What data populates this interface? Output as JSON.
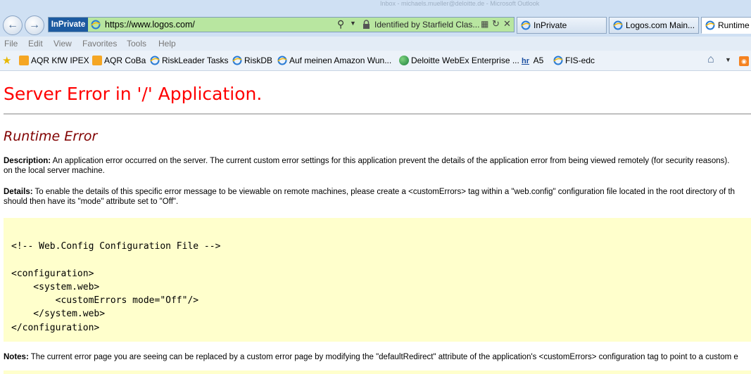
{
  "browser": {
    "faint_title": "Inbox - michaels.mueller@deloitte.de - Microsoft Outlook",
    "inprivate_label": "InPrivate",
    "url": "https://www.logos.com/",
    "identity": "Identified by Starfield Clas...",
    "tabs": [
      {
        "label": "InPrivate"
      },
      {
        "label": "Logos.com Main..."
      },
      {
        "label": "Runtime"
      }
    ],
    "menu": [
      "File",
      "Edit",
      "View",
      "Favorites",
      "Tools",
      "Help"
    ],
    "favorites": [
      {
        "label": "AQR KfW IPEX",
        "icon": "orange-app-icon"
      },
      {
        "label": "AQR CoBa",
        "icon": "orange-app-icon"
      },
      {
        "label": "RiskLeader Tasks",
        "icon": "ie-page-icon"
      },
      {
        "label": "RiskDB",
        "icon": "ie-page-icon"
      },
      {
        "label": "Auf meinen Amazon Wun...",
        "icon": "ie-page-icon"
      },
      {
        "label": "Deloitte WebEx Enterprise ...",
        "icon": "globe-icon"
      },
      {
        "label": "A5",
        "icon": "hr-icon",
        "icon_text": "hr"
      },
      {
        "label": "FIS-edc",
        "icon": "ie-page-icon"
      }
    ]
  },
  "page": {
    "heading": "Server Error in '/' Application.",
    "subheading": "Runtime Error",
    "description": {
      "label": "Description:",
      "line1": " An application error occurred on the server. The current custom error settings for this application prevent the details of the application error from being viewed remotely (for security reasons).",
      "line2": "on the local server machine."
    },
    "details": {
      "label": "Details:",
      "line1": " To enable the details of this specific error message to be viewable on remote machines, please create a <customErrors> tag within a \"web.config\" configuration file located in the root directory of th",
      "line2": "should then have its \"mode\" attribute set to \"Off\"."
    },
    "code": "<!-- Web.Config Configuration File -->\n\n<configuration>\n    <system.web>\n        <customErrors mode=\"Off\"/>\n    </system.web>\n</configuration>",
    "notes": {
      "label": "Notes:",
      "line1": " The current error page you are seeing can be replaced by a custom error page by modifying the \"defaultRedirect\" attribute of the application's <customErrors> configuration tag to point to a custom e"
    }
  }
}
